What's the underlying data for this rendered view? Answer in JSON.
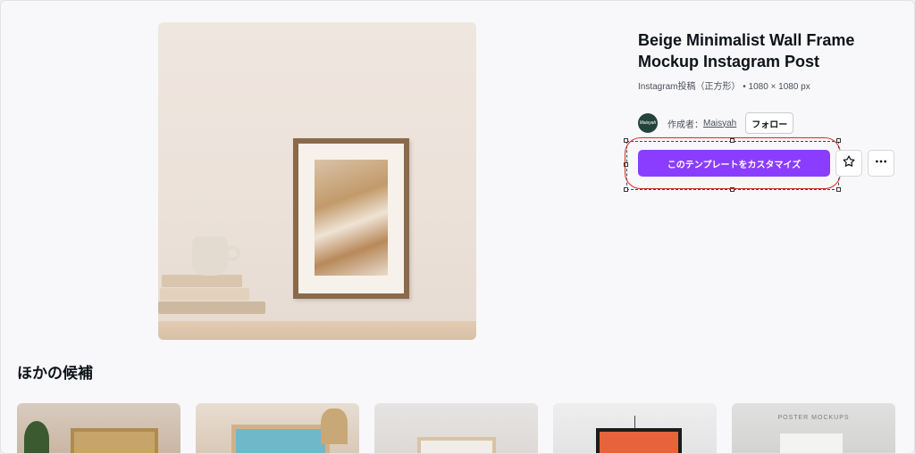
{
  "template": {
    "title": "Beige Minimalist Wall Frame Mockup Instagram Post",
    "meta": "Instagram投稿（正方形） • 1080 × 1080 px",
    "creator_label": "作成者：",
    "creator_name": "Maisyah",
    "avatar_text": "Maisyah",
    "follow_label": "フォロー",
    "customize_label": "このテンプレートをカスタマイズ",
    "star_icon": "star-outline-icon",
    "more_icon": "more-horizontal-icon"
  },
  "suggestions": {
    "heading": "ほかの候補",
    "items": [
      {
        "label": ""
      },
      {
        "label": ""
      },
      {
        "label": ""
      },
      {
        "label": ""
      },
      {
        "label": "POSTER MOCKUPS"
      }
    ]
  },
  "colors": {
    "accent": "#8b3dff",
    "highlight": "#d42a2a"
  }
}
